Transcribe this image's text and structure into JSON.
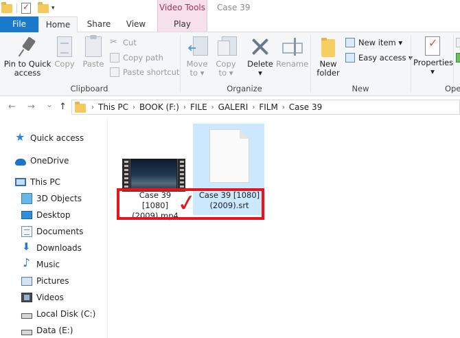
{
  "titlebar": {
    "contextual_group": "Video Tools",
    "window_title": "Case 39"
  },
  "tabs": {
    "file": "File",
    "home": "Home",
    "share": "Share",
    "view": "View",
    "play": "Play"
  },
  "ribbon": {
    "clipboard": {
      "label": "Clipboard",
      "pin_to_quick_access": "Pin to Quick\naccess",
      "copy": "Copy",
      "paste": "Paste",
      "cut": "Cut",
      "copy_path": "Copy path",
      "paste_shortcut": "Paste shortcut"
    },
    "organize": {
      "label": "Organize",
      "move_to": "Move\nto ▾",
      "copy_to": "Copy\nto ▾",
      "delete": "Delete\n▾",
      "rename": "Rename"
    },
    "new": {
      "label": "New",
      "new_folder": "New\nfolder",
      "new_item": "New item ▾",
      "easy_access": "Easy access ▾"
    },
    "open": {
      "label": "Ope",
      "properties": "Properties\n▾"
    }
  },
  "address": {
    "back_icon": "←",
    "forward_icon": "→",
    "dropdown_icon": "⌄",
    "up_icon": "↑",
    "crumbs": [
      "This PC",
      "BOOK (F:)",
      "FILE",
      "GALERI",
      "FILM",
      "Case 39"
    ]
  },
  "nav": {
    "quick_access": "Quick access",
    "onedrive": "OneDrive",
    "this_pc": "This PC",
    "objects_3d": "3D Objects",
    "desktop": "Desktop",
    "documents": "Documents",
    "downloads": "Downloads",
    "music": "Music",
    "pictures": "Pictures",
    "videos": "Videos",
    "local_disk": "Local Disk (C:)",
    "data_e": "Data (E:)"
  },
  "files": {
    "mp4_name": "Case 39 [1080]\n(2009).mp4",
    "srt_name": "Case 39 [1080]\n(2009).srt",
    "check": "✓"
  },
  "colors": {
    "file_tab": "#1979ca",
    "contextual_tab_bg": "#f6e1ea",
    "contextual_tab_text": "#a3305e",
    "selection": "#cce8ff",
    "annotation_red": "#e8141c"
  }
}
